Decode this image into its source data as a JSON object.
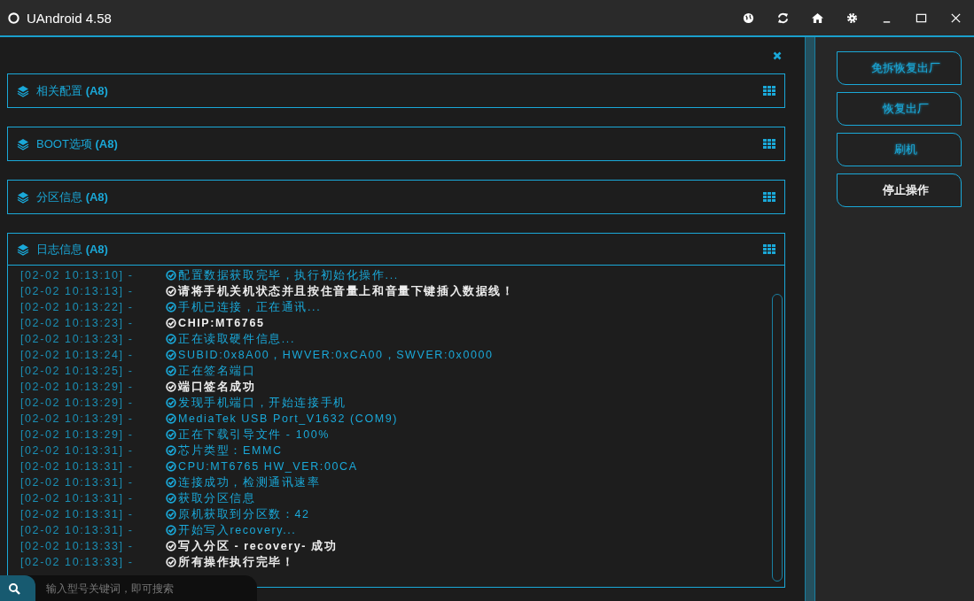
{
  "window": {
    "title": "UAndroid 4.58"
  },
  "sections": [
    {
      "title": "相关配置",
      "badge": "(A8)"
    },
    {
      "title": "BOOT选项",
      "badge": "(A8)"
    },
    {
      "title": "分区信息",
      "badge": "(A8)"
    },
    {
      "title": "日志信息",
      "badge": "(A8)"
    }
  ],
  "log": [
    {
      "time": "[02-02 10:13:10] -",
      "message": "配置数据获取完毕，执行初始化操作...",
      "kind": "info"
    },
    {
      "time": "[02-02 10:13:13] -",
      "message": "请将手机关机状态并且按住音量上和音量下键插入数据线！",
      "kind": "highlight"
    },
    {
      "time": "[02-02 10:13:22] -",
      "message": "手机已连接，正在通讯...",
      "kind": "info"
    },
    {
      "time": "[02-02 10:13:23] -",
      "message": "CHIP:MT6765",
      "kind": "highlight"
    },
    {
      "time": "[02-02 10:13:23] -",
      "message": "正在读取硬件信息...",
      "kind": "info"
    },
    {
      "time": "[02-02 10:13:24] -",
      "message": "SUBID:0x8A00，HWVER:0xCA00，SWVER:0x0000",
      "kind": "info"
    },
    {
      "time": "[02-02 10:13:25] -",
      "message": "正在签名端口",
      "kind": "info"
    },
    {
      "time": "[02-02 10:13:29] -",
      "message": "端口签名成功",
      "kind": "highlight"
    },
    {
      "time": "[02-02 10:13:29] -",
      "message": "发现手机端口，开始连接手机",
      "kind": "info"
    },
    {
      "time": "[02-02 10:13:29] -",
      "message": "MediaTek USB Port_V1632 (COM9)",
      "kind": "info"
    },
    {
      "time": "[02-02 10:13:29] -",
      "message": "正在下载引导文件 - 100%",
      "kind": "info"
    },
    {
      "time": "[02-02 10:13:31] -",
      "message": "芯片类型：EMMC",
      "kind": "info"
    },
    {
      "time": "[02-02 10:13:31] -",
      "message": "CPU:MT6765 HW_VER:00CA",
      "kind": "info"
    },
    {
      "time": "[02-02 10:13:31] -",
      "message": "连接成功，检测通讯速率",
      "kind": "info"
    },
    {
      "time": "[02-02 10:13:31] -",
      "message": "获取分区信息",
      "kind": "info"
    },
    {
      "time": "[02-02 10:13:31] -",
      "message": "原机获取到分区数：42",
      "kind": "info"
    },
    {
      "time": "[02-02 10:13:31] -",
      "message": "开始写入recovery...",
      "kind": "info"
    },
    {
      "time": "[02-02 10:13:33] -",
      "message": "写入分区 - recovery- 成功",
      "kind": "highlight"
    },
    {
      "time": "[02-02 10:13:33] -",
      "message": "所有操作执行完毕！",
      "kind": "highlight"
    }
  ],
  "search": {
    "placeholder": "输入型号关键词，即可搜索"
  },
  "actions": [
    {
      "label": "免拆恢复出厂",
      "kind": "normal"
    },
    {
      "label": "恢复出厂",
      "kind": "normal"
    },
    {
      "label": "刷机",
      "kind": "normal"
    },
    {
      "label": "停止操作",
      "kind": "stop"
    }
  ]
}
